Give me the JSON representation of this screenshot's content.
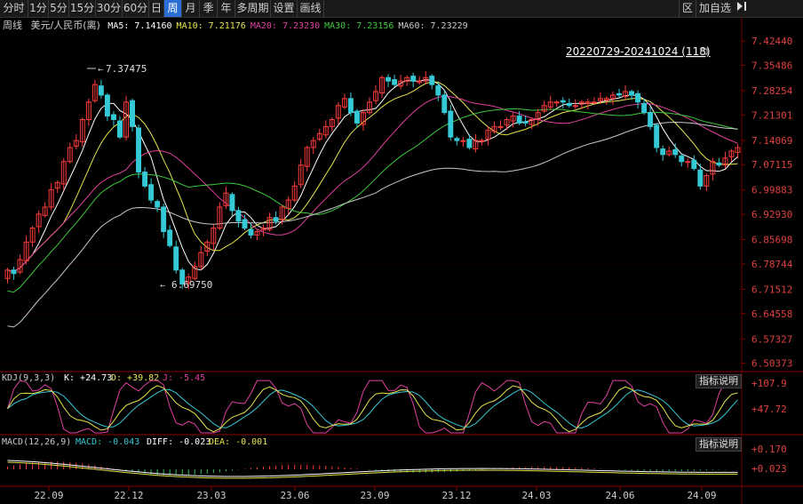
{
  "toolbar": {
    "periods": [
      "分时",
      "1分",
      "5分",
      "15分",
      "30分",
      "60分",
      "日",
      "周",
      "月",
      "季",
      "年",
      "多周期"
    ],
    "active_period": "周",
    "extras": [
      "设置",
      "画线"
    ],
    "right": {
      "zone_label": "区",
      "add_label": "加自选",
      "arrow_icon": "collapse-right-icon"
    }
  },
  "info": {
    "period": "周线",
    "instrument": "美元/人民币(离)",
    "ma": [
      {
        "label": "MA5:",
        "value": "7.14160",
        "color": "#ffffff"
      },
      {
        "label": "MA10:",
        "value": "7.21176",
        "color": "#e6e64c"
      },
      {
        "label": "MA20:",
        "value": "7.23230",
        "color": "#e040a0"
      },
      {
        "label": "MA30:",
        "value": "7.23156",
        "color": "#3cc83c"
      },
      {
        "label": "MA60:",
        "value": "7.23229",
        "color": "#c8c8c8"
      }
    ]
  },
  "range_label": "20220729-20241024 (118)",
  "price_axis": [
    "7.42440",
    "7.35486",
    "7.28254",
    "7.21301",
    "7.14069",
    "7.07115",
    "6.99883",
    "6.92930",
    "6.85698",
    "6.78744",
    "6.71512",
    "6.64558",
    "6.57327",
    "6.50373"
  ],
  "annotations": {
    "high": "7.37475",
    "low": "6.69750"
  },
  "kdj": {
    "params": "KDJ(9,3,3)",
    "k": "K: +24.73",
    "d": "D: +39.82",
    "j": "J: -5.45",
    "axis": [
      "+107.9",
      "+47.72"
    ],
    "help": "指标说明"
  },
  "macd": {
    "params": "MACD(12,26,9)",
    "macd": "MACD: -0.043",
    "diff": "DIFF: -0.023",
    "dea": "DEA: -0.001",
    "axis": [
      "+0.170",
      "+0.023"
    ],
    "help": "指标说明"
  },
  "x_axis": [
    "22.09",
    "22.12",
    "23.03",
    "23.06",
    "23.09",
    "23.12",
    "24.03",
    "24.06",
    "24.09"
  ],
  "colors": {
    "up": "#ff3b3b",
    "down": "#35c9d6",
    "ma5": "#ffffff",
    "ma10": "#e6e64c",
    "ma20": "#e040a0",
    "ma30": "#3cc83c",
    "ma60": "#c8c8c8",
    "grid": "#5a0000"
  },
  "chart_data": {
    "type": "candlestick",
    "y_range": [
      6.48,
      7.44
    ],
    "closes": [
      6.77,
      6.76,
      6.8,
      6.85,
      6.89,
      6.93,
      6.95,
      7.0,
      7.02,
      7.08,
      7.12,
      7.14,
      7.2,
      7.25,
      7.3,
      7.27,
      7.21,
      7.2,
      7.15,
      7.25,
      7.18,
      7.05,
      7.01,
      6.97,
      6.95,
      6.88,
      6.84,
      6.77,
      6.73,
      6.75,
      6.78,
      6.82,
      6.85,
      6.89,
      6.95,
      6.99,
      6.94,
      6.91,
      6.89,
      6.87,
      6.88,
      6.89,
      6.92,
      6.91,
      6.95,
      6.97,
      7.01,
      7.07,
      7.12,
      7.14,
      7.16,
      7.18,
      7.2,
      7.24,
      7.26,
      7.22,
      7.19,
      7.22,
      7.25,
      7.28,
      7.32,
      7.31,
      7.3,
      7.31,
      7.32,
      7.31,
      7.31,
      7.32,
      7.3,
      7.27,
      7.22,
      7.15,
      7.14,
      7.14,
      7.12,
      7.14,
      7.14,
      7.17,
      7.18,
      7.18,
      7.2,
      7.21,
      7.19,
      7.19,
      7.2,
      7.22,
      7.24,
      7.25,
      7.25,
      7.25,
      7.24,
      7.24,
      7.25,
      7.25,
      7.25,
      7.26,
      7.26,
      7.27,
      7.27,
      7.28,
      7.27,
      7.25,
      7.22,
      7.18,
      7.12,
      7.1,
      7.11,
      7.1,
      7.08,
      7.08,
      7.06,
      7.01,
      7.04,
      7.08,
      7.07,
      7.09,
      7.11,
      7.12
    ]
  }
}
